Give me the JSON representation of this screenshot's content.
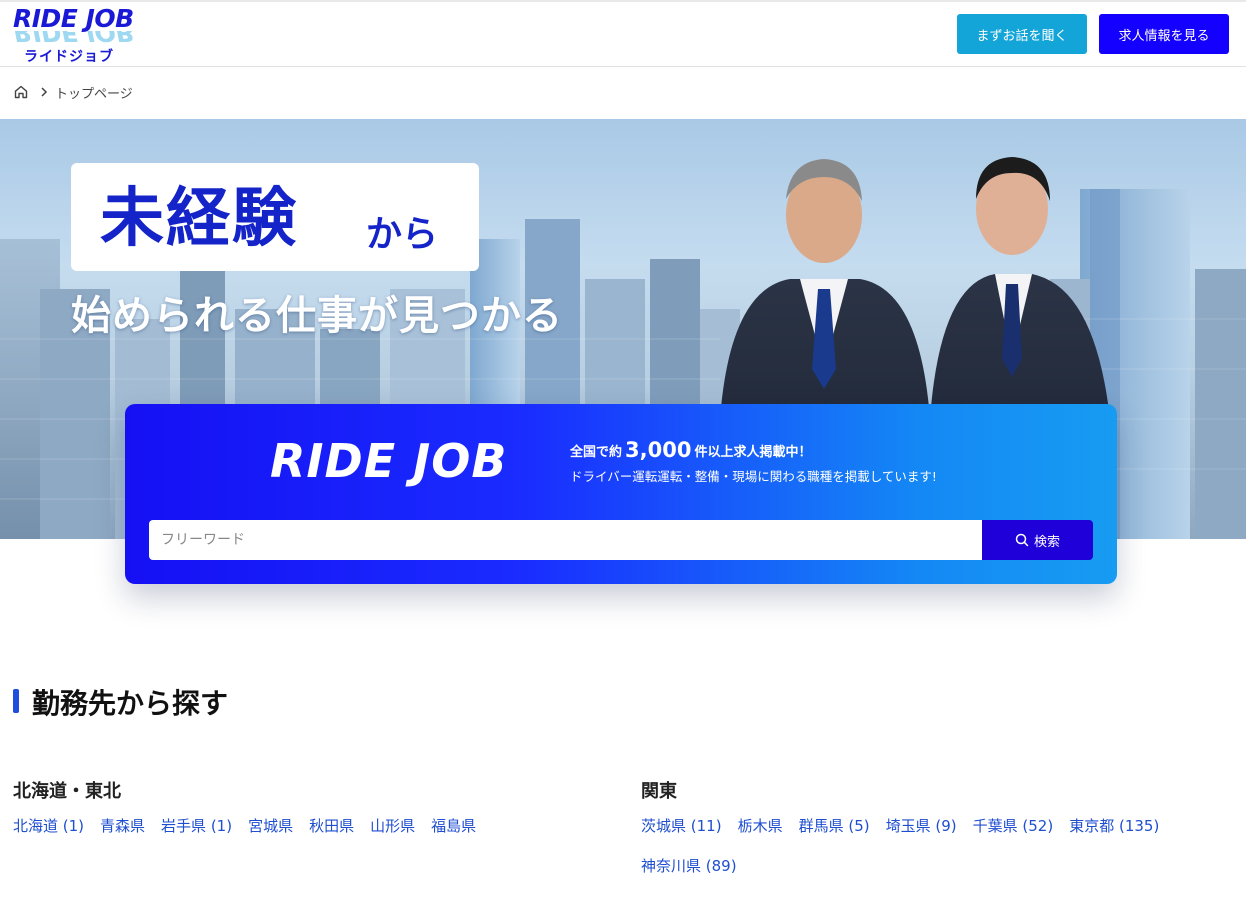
{
  "header": {
    "logo_text": "RIDE JOB",
    "logo_kana": "ライドジョブ",
    "btn_talk": "まずお話を聞く",
    "btn_jobs": "求人情報を見る"
  },
  "breadcrumb": {
    "current": "トップページ"
  },
  "hero": {
    "headline_main": "未経験",
    "headline_suffix": "から",
    "headline_sub": "始められる仕事が見つかる"
  },
  "search": {
    "card_logo": "RIDE JOB",
    "line1_prefix": "全国で約",
    "line1_number": "3,000",
    "line1_suffix": "件以上求人掲載中！",
    "line2": "ドライバー運転運転・整備・現場に関わる職種を掲載しています!",
    "placeholder": "フリーワード",
    "button_label": "検索"
  },
  "section": {
    "title": "勤務先から探す",
    "regions": [
      {
        "name": "北海道・東北",
        "prefectures": [
          "北海道 (1)",
          "青森県",
          "岩手県 (1)",
          "宮城県",
          "秋田県",
          "山形県",
          "福島県"
        ]
      },
      {
        "name": "関東",
        "prefectures": [
          "茨城県 (11)",
          "栃木県",
          "群馬県 (5)",
          "埼玉県 (9)",
          "千葉県 (52)",
          "東京都 (135)",
          "神奈川県 (89)"
        ]
      }
    ]
  },
  "colors": {
    "brand_blue": "#1400ff",
    "accent_cyan": "#14a5d8",
    "link_blue": "#1f4fd0"
  }
}
